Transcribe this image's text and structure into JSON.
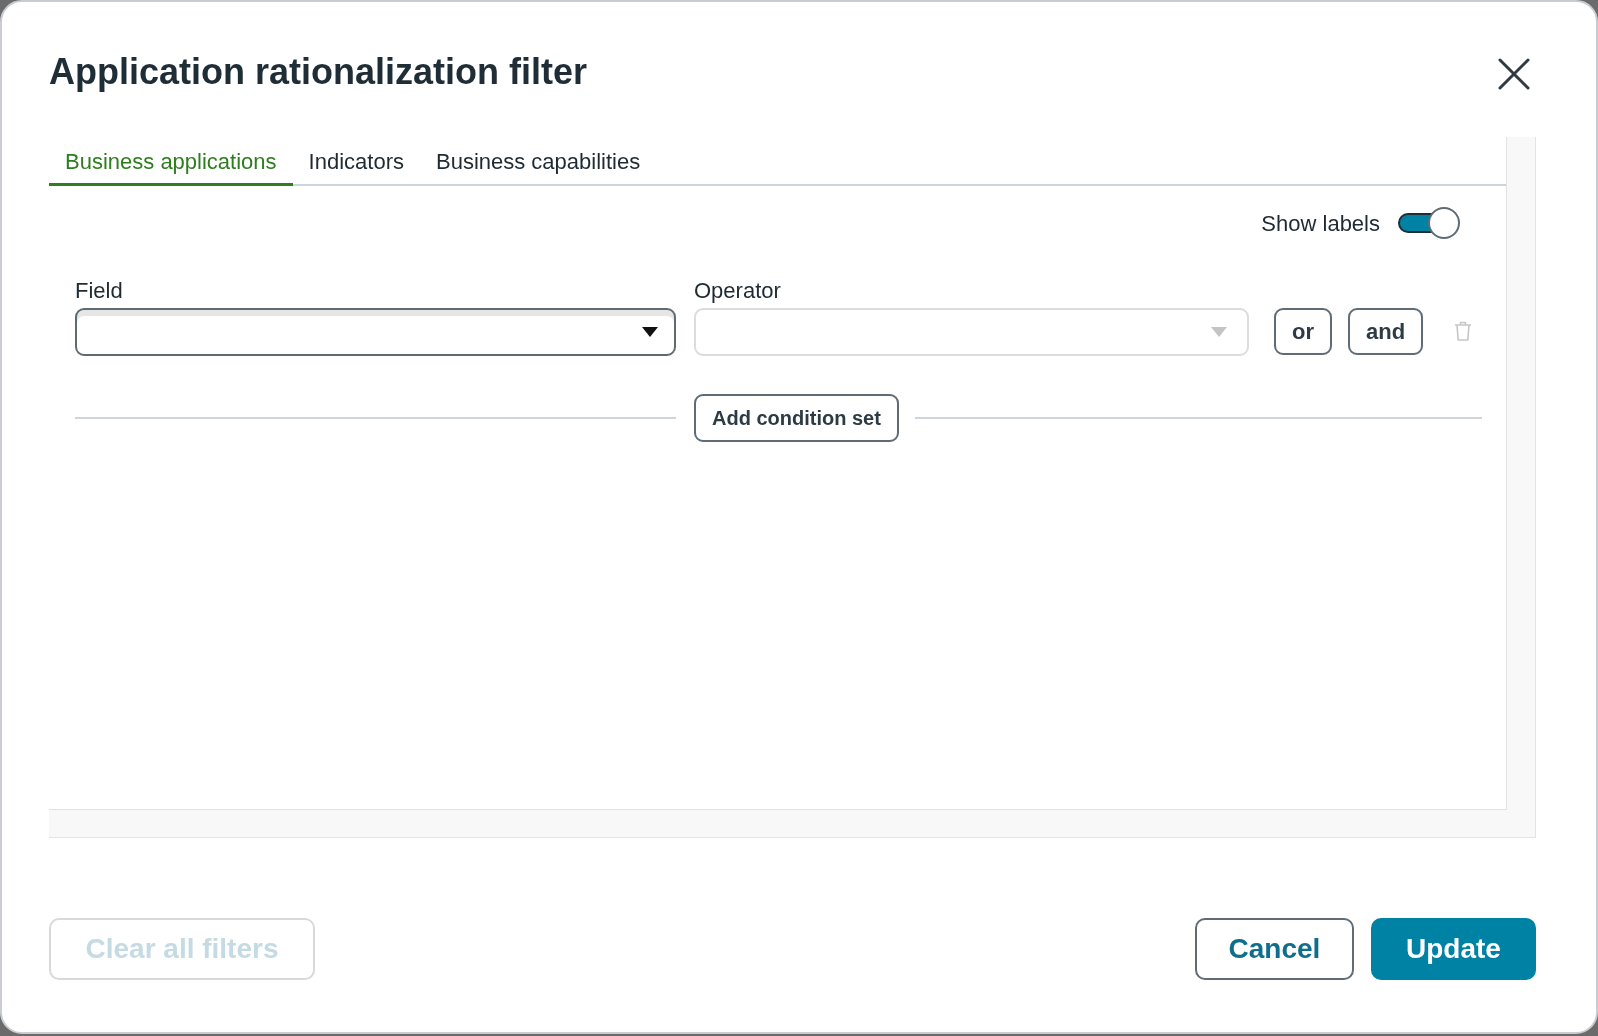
{
  "dialog": {
    "title": "Application rationalization filter"
  },
  "tabs": [
    {
      "label": "Business applications",
      "selected": true
    },
    {
      "label": "Indicators",
      "selected": false
    },
    {
      "label": "Business capabilities",
      "selected": false
    }
  ],
  "show_labels": {
    "label": "Show labels",
    "on": true
  },
  "condition": {
    "field": {
      "label": "Field",
      "disabled": false
    },
    "operator": {
      "label": "Operator",
      "disabled": true
    },
    "buttons": [
      "or",
      "and"
    ],
    "delete": {
      "disabled": true
    }
  },
  "add_condition_set": "Add condition set",
  "footer": {
    "clear": {
      "label": "Clear all filters",
      "disabled": true
    },
    "cancel": "Cancel",
    "update": "Update"
  }
}
